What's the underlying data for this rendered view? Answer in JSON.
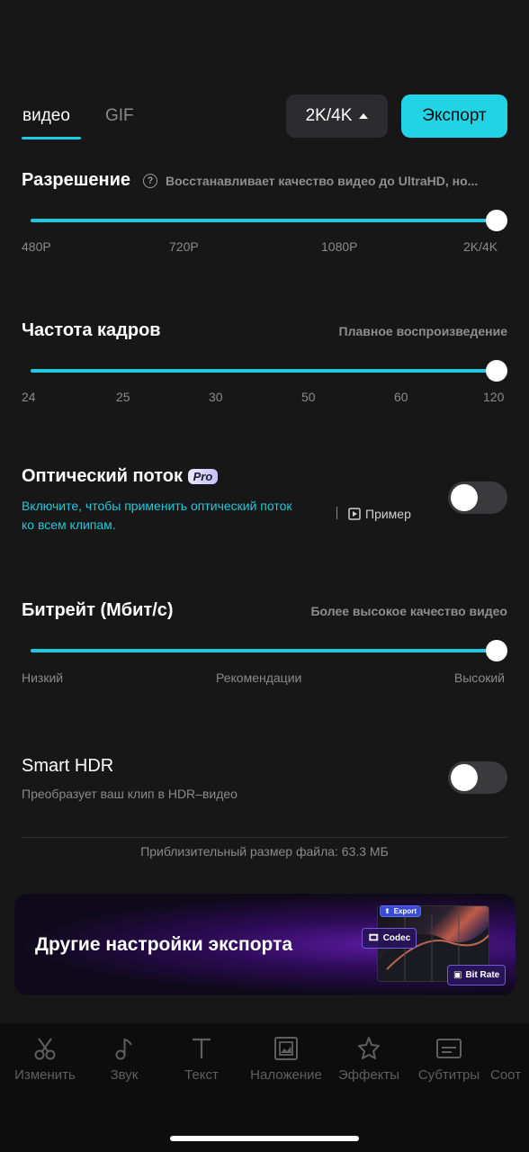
{
  "tabs": [
    {
      "label": "видео",
      "active": true
    },
    {
      "label": "GIF",
      "active": false
    }
  ],
  "resolution_select": {
    "value": "2K/4K"
  },
  "export_button": {
    "label": "Экспорт"
  },
  "resolution": {
    "title": "Разрешение",
    "hint": "Восстанавливает качество видео до UltraHD, но...",
    "ticks": [
      "480P",
      "720P",
      "1080P",
      "2K/4K"
    ],
    "selected": "2K/4K"
  },
  "frame_rate": {
    "title": "Частота кадров",
    "hint": "Плавное воспроизведение",
    "ticks": [
      "24",
      "25",
      "30",
      "50",
      "60",
      "120"
    ],
    "selected": "120"
  },
  "optical_flow": {
    "title": "Оптический поток",
    "badge": "Pro",
    "description_line1": "Включите, чтобы применить оптический поток",
    "description_line2": "ко всем клипам.",
    "example_label": "Пример",
    "enabled": false
  },
  "bitrate": {
    "title": "Битрейт (Мбит/с)",
    "hint": "Более высокое качество видео",
    "ticks": [
      "Низкий",
      "Рекомендации",
      "Высокий"
    ],
    "selected": "Высокий"
  },
  "smart_hdr": {
    "title": "Smart HDR",
    "description": "Преобразует ваш клип в HDR–видео",
    "enabled": false
  },
  "file_size": "Приблизительный размер файла: 63.3 МБ",
  "banner": {
    "title": "Другие настройки экспорта",
    "thumb_label": "Export",
    "chip_codec": "Codec",
    "chip_bitrate": "Bit Rate"
  },
  "bottom_nav": [
    {
      "label": "Изменить",
      "icon": "scissors-icon"
    },
    {
      "label": "Звук",
      "icon": "music-note-icon"
    },
    {
      "label": "Текст",
      "icon": "text-icon"
    },
    {
      "label": "Наложение",
      "icon": "overlay-icon"
    },
    {
      "label": "Эффекты",
      "icon": "effects-star-icon"
    },
    {
      "label": "Субтитры",
      "icon": "subtitles-icon"
    },
    {
      "label": "Соот",
      "icon": "aspect-ratio-icon"
    }
  ],
  "colors": {
    "accent": "#22c9dd",
    "background": "#171717"
  }
}
